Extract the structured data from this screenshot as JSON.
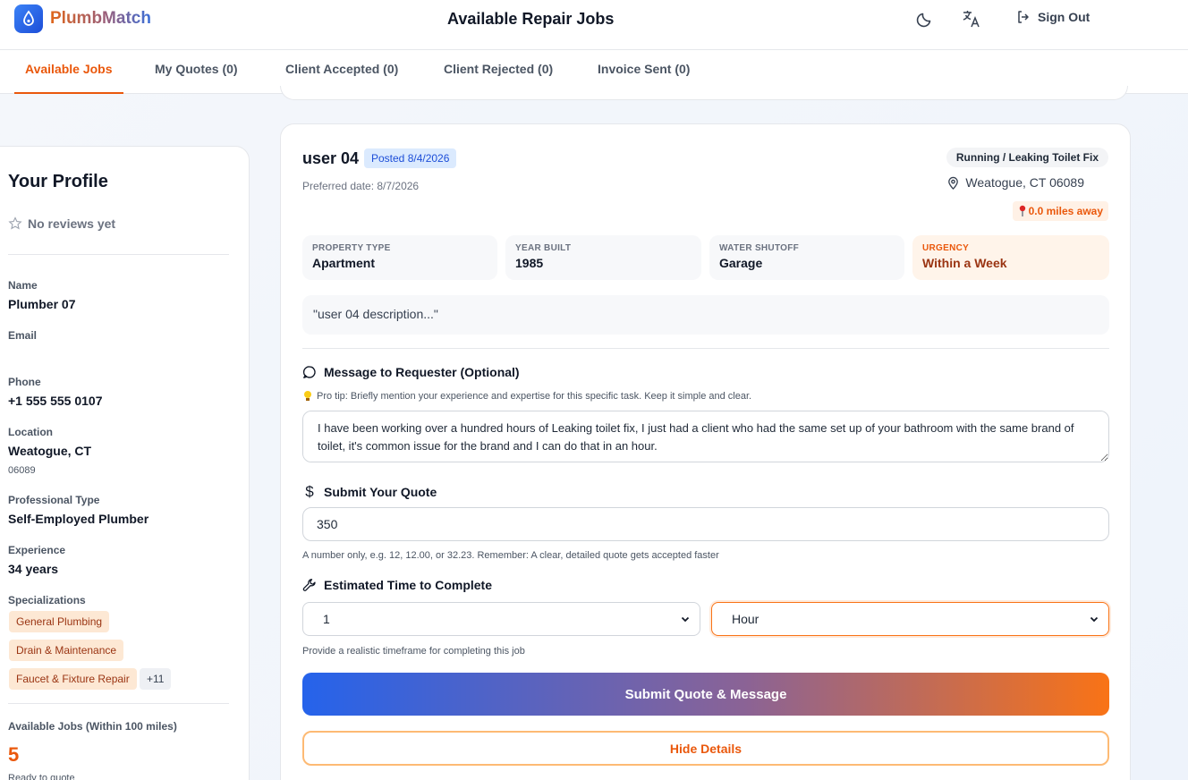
{
  "app": {
    "name": "PlumbMatch",
    "page_title": "Available Repair Jobs",
    "sign_out_label": "Sign Out",
    "brand_color": "#ea580c",
    "accent_color": "#2563eb"
  },
  "header_icons": [
    "moon-icon",
    "translate-icon",
    "sign-out-icon"
  ],
  "tabs": [
    {
      "label": "Available Jobs",
      "active": true
    },
    {
      "label": "My Quotes (0)",
      "active": false
    },
    {
      "label": "Client Accepted (0)",
      "active": false
    },
    {
      "label": "Client Rejected (0)",
      "active": false
    },
    {
      "label": "Invoice Sent (0)",
      "active": false
    }
  ],
  "profile": {
    "title": "Your Profile",
    "reviews": "No reviews yet",
    "name_label": "Name",
    "name": "Plumber 07",
    "email_label": "Email",
    "email": "",
    "phone_label": "Phone",
    "phone": "+1 555 555 0107",
    "location_label": "Location",
    "location": "Weatogue, CT",
    "zip": "06089",
    "type_label": "Professional Type",
    "type": "Self-Employed Plumber",
    "experience_label": "Experience",
    "experience": "34 years",
    "specializations_label": "Specializations",
    "specializations": [
      "General Plumbing",
      "Drain & Maintenance",
      "Faucet & Fixture Repair"
    ],
    "more_specializations": "+11",
    "available_label": "Available Jobs (Within 100 miles)",
    "available_count": "5",
    "available_sub": "Ready to quote"
  },
  "job": {
    "user": "user 04",
    "posted": "Posted 8/4/2026",
    "preferred_date": "Preferred date: 8/7/2026",
    "job_type": "Running / Leaking Toilet Fix",
    "location": "Weatogue, CT 06089",
    "distance": "0.0 miles away",
    "details": [
      {
        "key": "PROPERTY TYPE",
        "value": "Apartment"
      },
      {
        "key": "YEAR BUILT",
        "value": "1985"
      },
      {
        "key": "WATER SHUTOFF",
        "value": "Garage"
      },
      {
        "key": "URGENCY",
        "value": "Within a Week"
      }
    ],
    "description": "\"user 04 description...\""
  },
  "message": {
    "label": "Message to Requester (Optional)",
    "tip": "Pro tip: Briefly mention your experience and expertise for this specific task. Keep it simple and clear.",
    "value": "I have been working over a hundred hours of Leaking toilet fix, I just had a client who had the same set up of your bathroom with the same brand of toilet, it's common issue for the brand and I can do that in an hour."
  },
  "quote": {
    "label": "Submit Your Quote",
    "value": "350",
    "hint": "A number only, e.g. 12, 12.00, or 32.23. Remember: A clear, detailed quote gets accepted faster"
  },
  "time": {
    "label": "Estimated Time to Complete",
    "amount": "1",
    "unit": "Hour",
    "hint": "Provide a realistic timeframe for completing this job"
  },
  "actions": {
    "submit": "Submit Quote & Message",
    "hide": "Hide Details"
  }
}
